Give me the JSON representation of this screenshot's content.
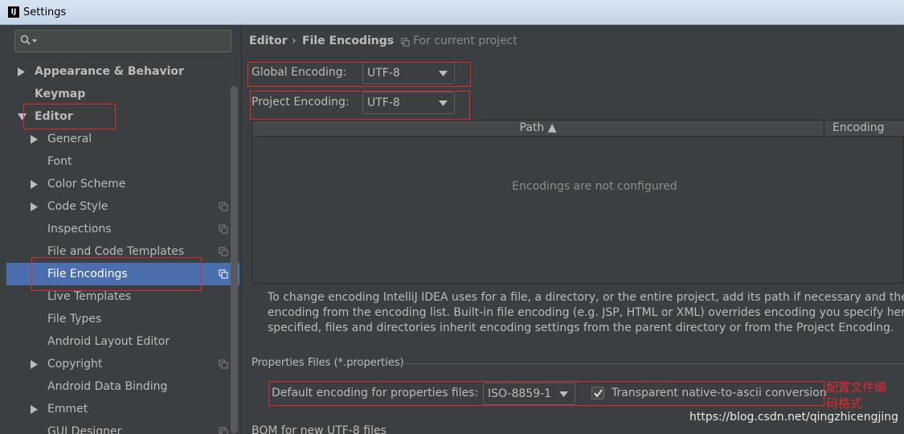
{
  "window": {
    "title": "Settings",
    "icon_text": "IJ"
  },
  "search": {
    "placeholder": ""
  },
  "sidebar": {
    "items": [
      {
        "label": "Appearance & Behavior"
      },
      {
        "label": "Keymap"
      },
      {
        "label": "Editor"
      },
      {
        "label": "General"
      },
      {
        "label": "Font"
      },
      {
        "label": "Color Scheme"
      },
      {
        "label": "Code Style"
      },
      {
        "label": "Inspections"
      },
      {
        "label": "File and Code Templates"
      },
      {
        "label": "File Encodings"
      },
      {
        "label": "Live Templates"
      },
      {
        "label": "File Types"
      },
      {
        "label": "Android Layout Editor"
      },
      {
        "label": "Copyright"
      },
      {
        "label": "Android Data Binding"
      },
      {
        "label": "Emmet"
      },
      {
        "label": "GUI Designer"
      }
    ]
  },
  "breadcrumb": {
    "parent": "Editor",
    "separator": "›",
    "current": "File Encodings",
    "scope": "For current project"
  },
  "global_encoding": {
    "label": "Global Encoding:",
    "value": "UTF-8"
  },
  "project_encoding": {
    "label": "Project Encoding:",
    "value": "UTF-8"
  },
  "table": {
    "columns": [
      {
        "label": "Path ▲"
      },
      {
        "label": "Encoding"
      }
    ],
    "empty_text": "Encodings are not configured"
  },
  "info": {
    "lines": [
      "To change encoding IntelliJ IDEA uses for a file, a directory, or the entire project, add its path if necessary and then sel",
      "encoding from the encoding list. Built-in file encoding (e.g. JSP, HTML or XML) overrides encoding you specify here. If",
      "specified, files and directories inherit encoding settings from the parent directory or from the Project Encoding."
    ]
  },
  "properties": {
    "section_title": "Properties Files (*.properties)",
    "default_label": "Default encoding for properties files:",
    "default_value": "ISO-8859-1",
    "native_label": "Transparent native-to-ascii conversion",
    "native_checked": true
  },
  "bom": {
    "label": "BOM for new UTF-8 files"
  },
  "annotation": {
    "line1": "配置文件编",
    "line2": "码格式"
  },
  "watermark": "https://blog.csdn.net/qingzhicengjing",
  "colors": {
    "selection": "#4b6eaf",
    "highlight_box": "#e0292e",
    "background": "#3c3f41"
  }
}
